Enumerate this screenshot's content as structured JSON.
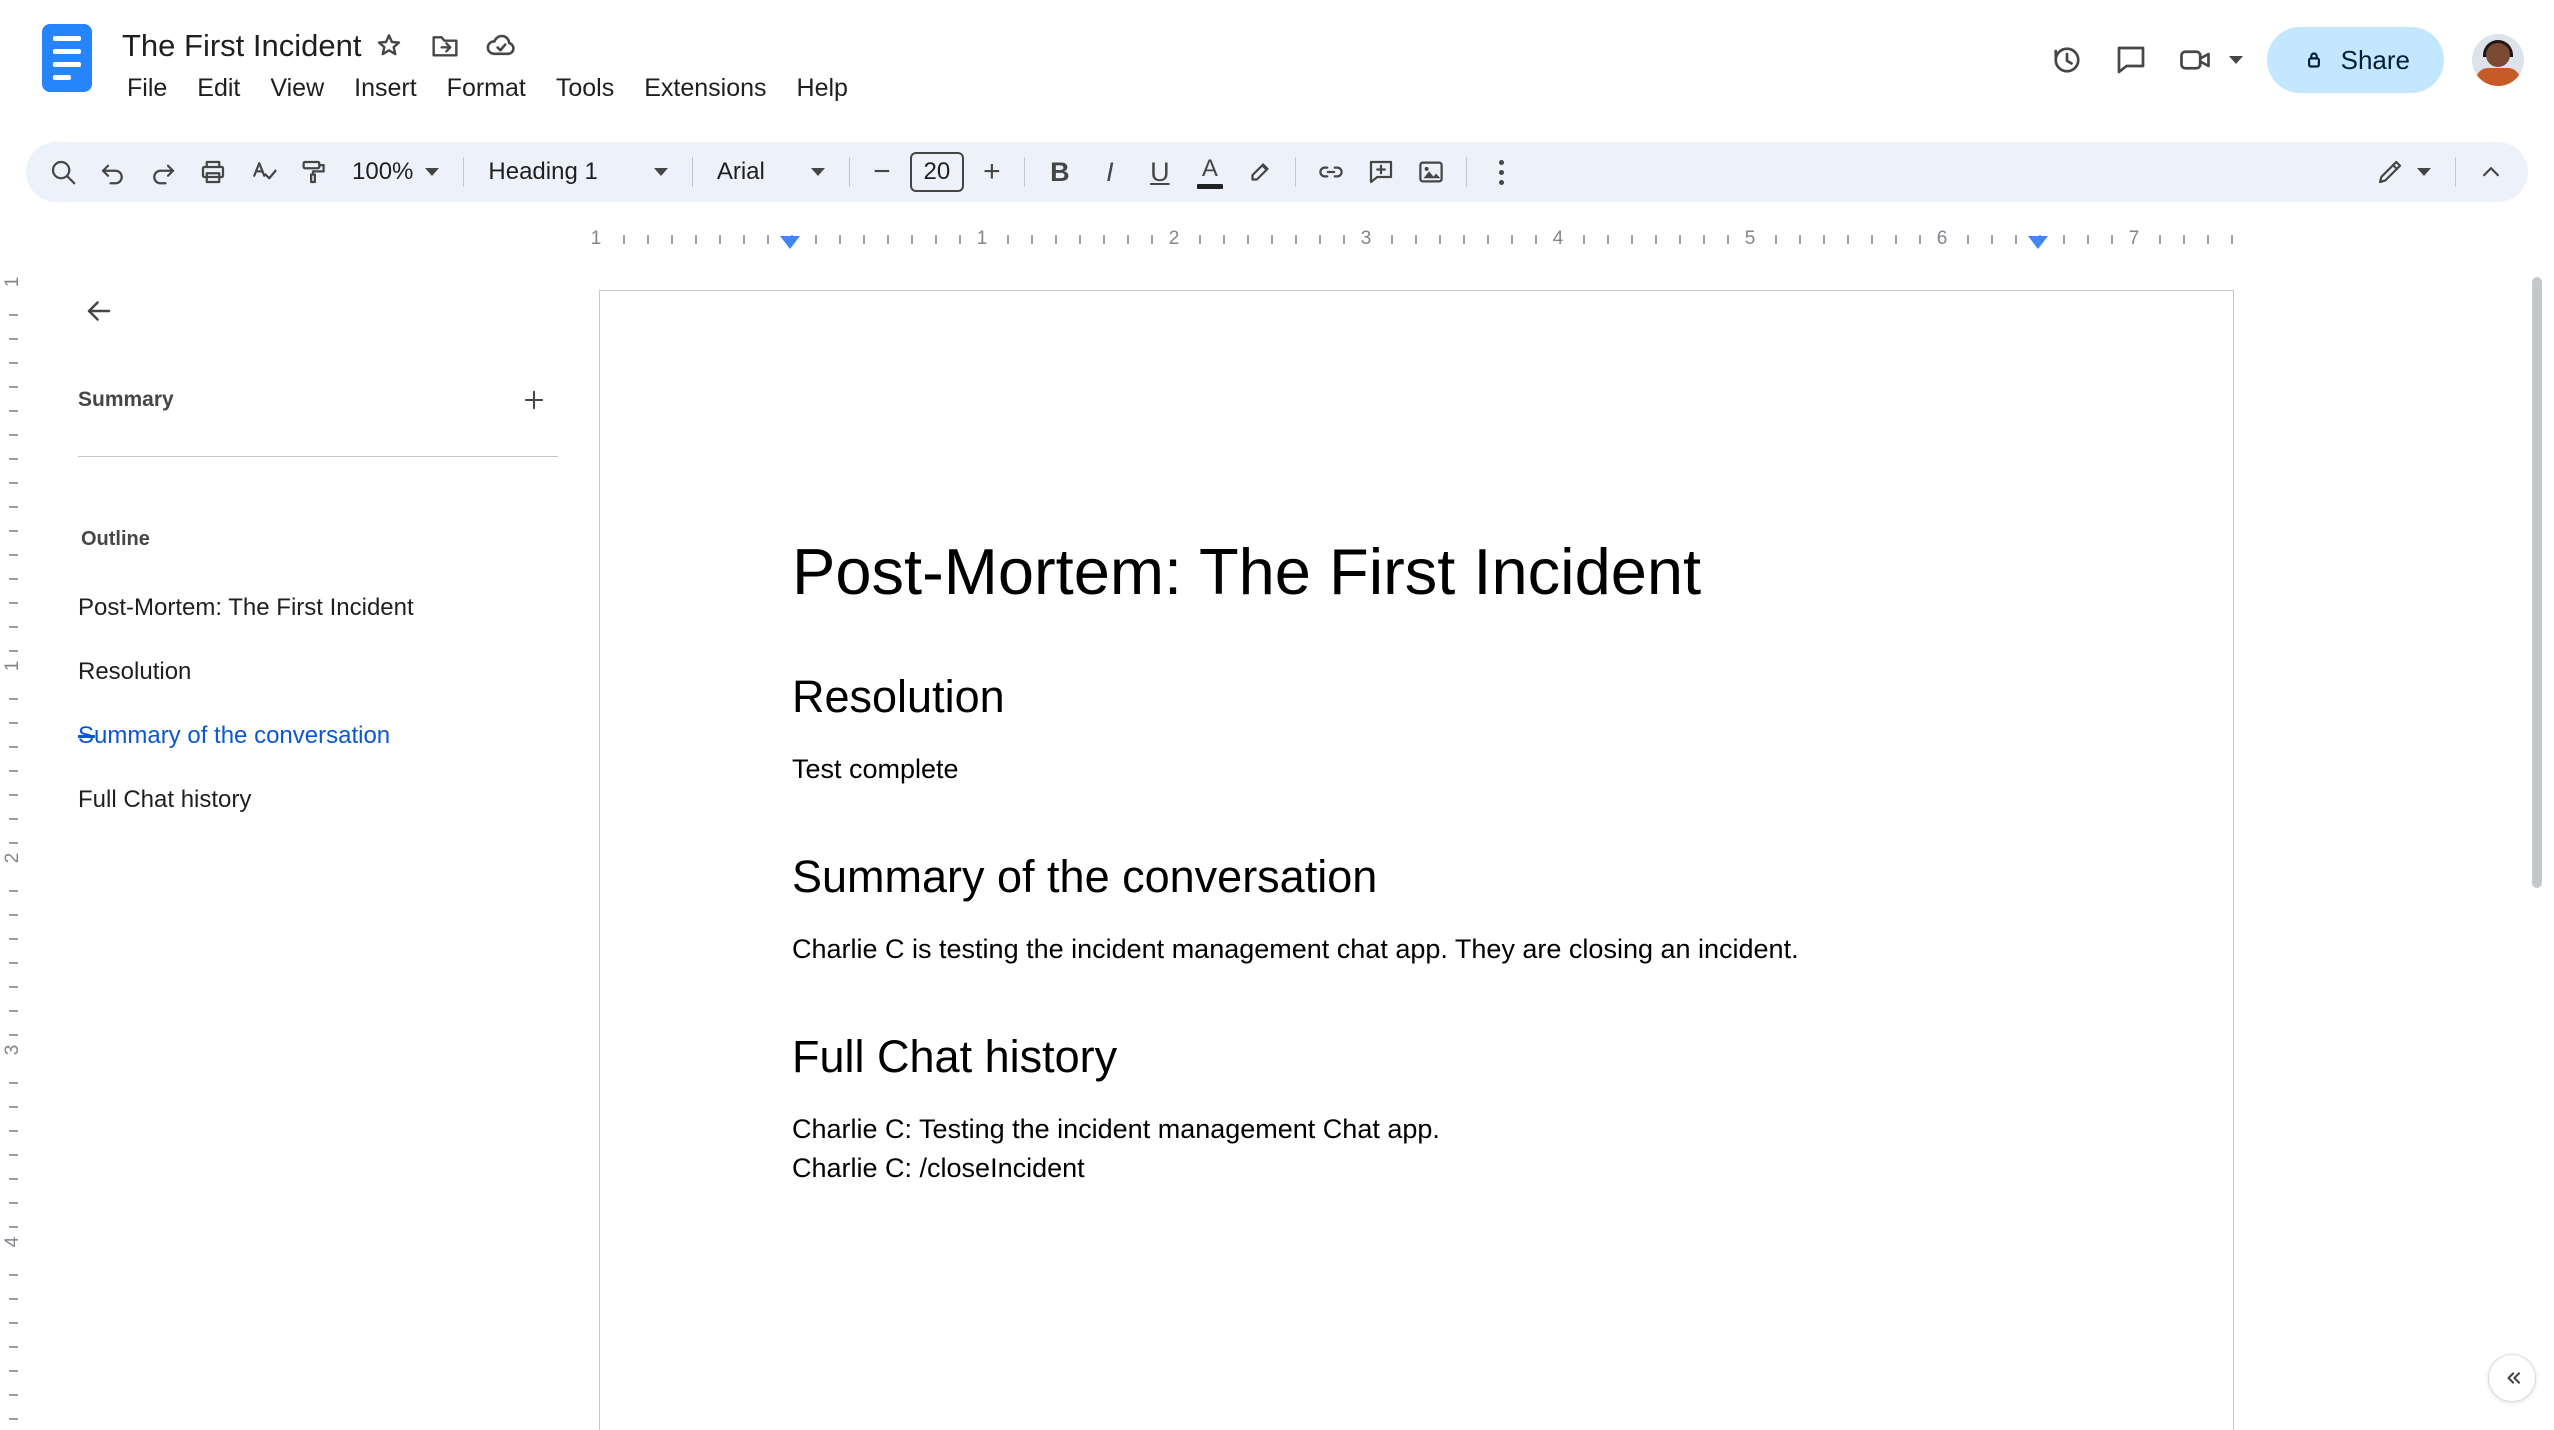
{
  "header": {
    "title": "The First Incident",
    "menu": [
      "File",
      "Edit",
      "View",
      "Insert",
      "Format",
      "Tools",
      "Extensions",
      "Help"
    ],
    "share_label": "Share"
  },
  "toolbar": {
    "zoom": "100%",
    "paragraph_style": "Heading 1",
    "font": "Arial",
    "font_size": "20",
    "decrease_label": "−",
    "increase_label": "+",
    "bold_label": "B",
    "italic_label": "I",
    "underline_label": "U",
    "text_color_label": "A"
  },
  "ruler": {
    "h_numbers": [
      "1",
      "1",
      "2",
      "3",
      "4",
      "5",
      "6",
      "7"
    ],
    "v_numbers": [
      "1",
      "1",
      "2",
      "3",
      "4"
    ]
  },
  "sidebar": {
    "summary_label": "Summary",
    "outline_label": "Outline",
    "items": [
      {
        "label": "Post-Mortem: The First Incident",
        "active": false
      },
      {
        "label": "Resolution",
        "active": false
      },
      {
        "label": "Summary of the conversation",
        "active": true
      },
      {
        "label": "Full Chat history",
        "active": false
      }
    ]
  },
  "document": {
    "h1": "Post-Mortem: The First Incident",
    "sections": [
      {
        "heading": "Resolution",
        "body": [
          "Test complete"
        ]
      },
      {
        "heading": "Summary of the conversation",
        "body": [
          "Charlie C is testing the incident management chat app. They are closing an incident."
        ]
      },
      {
        "heading": "Full Chat history",
        "body": [
          "Charlie C: Testing the incident management Chat app.",
          "Charlie C: /closeIncident"
        ]
      }
    ]
  },
  "colors": {
    "accent_blue": "#0b57d0",
    "share_bg": "#c2e7ff",
    "toolbar_bg": "#edf2fa",
    "docs_logo_blue": "#2684fc",
    "ruler_marker_blue": "#4285f4"
  }
}
